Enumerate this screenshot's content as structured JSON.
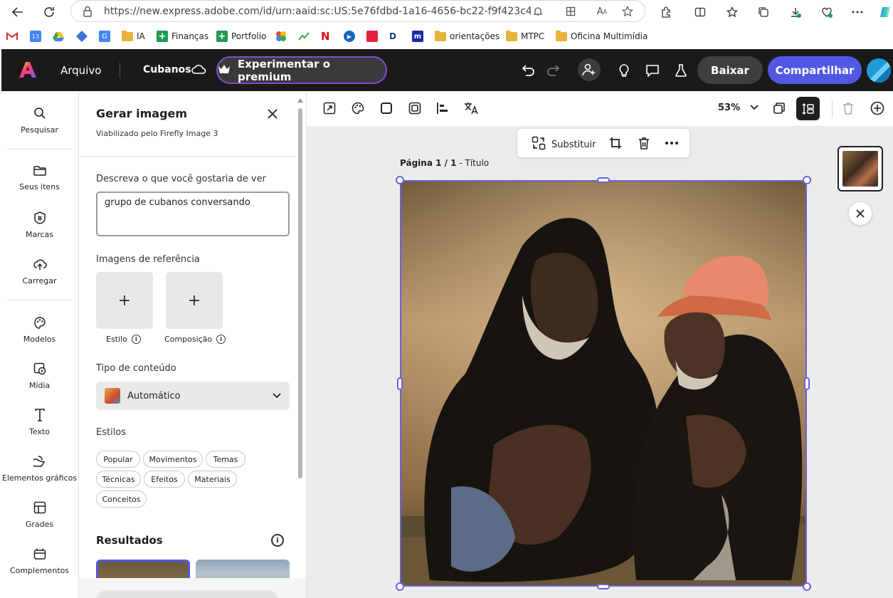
{
  "browser": {
    "url": "https://new.express.adobe.com/id/urn:aaid:sc:US:5e76fdbd-1a16-4656-bc22-f9f423c499e2?c...",
    "bookmarks": [
      {
        "label": "IA",
        "icon": "folder-icon"
      },
      {
        "label": "Finanças",
        "icon": "sheets-icon"
      },
      {
        "label": "Portfolio",
        "icon": "sheets-icon"
      },
      {
        "label": "orientações",
        "icon": "folder-icon"
      },
      {
        "label": "MTPC",
        "icon": "folder-icon"
      },
      {
        "label": "Oficina Multimídia",
        "icon": "folder-icon"
      }
    ]
  },
  "header": {
    "menu_file": "Arquivo",
    "doc_title": "Cubanos",
    "premium_label": "Experimentar o premium",
    "download_label": "Baixar",
    "share_label": "Compartilhar",
    "colors": {
      "bg": "#1a1a1a",
      "accent": "#5258e4",
      "premium_border": "#7b4fd6"
    }
  },
  "left_rail": {
    "items": [
      {
        "label": "Pesquisar",
        "icon": "search-icon"
      },
      {
        "label": "Seus itens",
        "icon": "folder-icon"
      },
      {
        "label": "Marcas",
        "icon": "brand-icon"
      },
      {
        "label": "Carregar",
        "icon": "upload-icon"
      },
      {
        "label": "Modelos",
        "icon": "templates-icon"
      },
      {
        "label": "Mídia",
        "icon": "media-icon"
      },
      {
        "label": "Texto",
        "icon": "text-icon"
      },
      {
        "label": "Elementos gráficos",
        "icon": "shapes-icon"
      },
      {
        "label": "Grades",
        "icon": "grid-icon"
      },
      {
        "label": "Complementos",
        "icon": "addons-icon"
      }
    ]
  },
  "panel": {
    "title": "Gerar imagem",
    "subtitle": "Viabilizado pelo Firefly Image 3",
    "prompt_label": "Descreva o que você gostaria de ver",
    "prompt_value": "grupo de cubanos conversando",
    "reference_label": "Imagens de referência",
    "ref_style": "Estilo",
    "ref_composition": "Composição",
    "content_type_label": "Tipo de conteúdo",
    "content_type_value": "Automático",
    "styles_label": "Estilos",
    "style_chips": [
      "Popular",
      "Movimentos",
      "Temas",
      "Técnicas",
      "Efeitos",
      "Materiais",
      "Conceitos"
    ],
    "results_label": "Resultados"
  },
  "canvas": {
    "zoom": "53%",
    "context_replace": "Substituir",
    "page_label_bold": "Página 1 / 1",
    "page_label_rest": " - Título"
  }
}
